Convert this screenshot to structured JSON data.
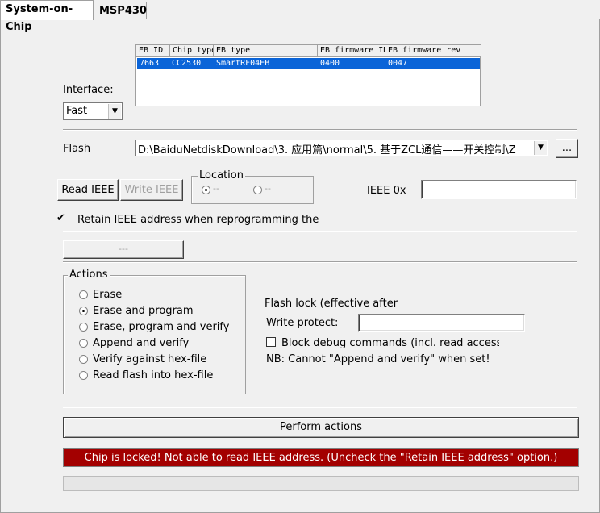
{
  "tabs": [
    {
      "label": "System-on-Chip",
      "active": true
    },
    {
      "label": "MSP430",
      "active": false
    }
  ],
  "interface": {
    "label": "Interface:",
    "value": "Fast"
  },
  "device_list": {
    "columns": [
      "EB ID",
      "Chip type",
      "EB type",
      "EB firmware ID",
      "EB firmware rev"
    ],
    "rows": [
      [
        "7663",
        "CC2530",
        "SmartRF04EB",
        "0400",
        "0047"
      ]
    ]
  },
  "flash": {
    "label": "Flash",
    "path": "D:\\BaiduNetdiskDownload\\3. 应用篇\\normal\\5. 基于ZCL通信——开关控制\\Z",
    "browse_label": "..."
  },
  "ieee": {
    "read_label": "Read IEEE",
    "write_label": "Write IEEE",
    "location_title": "Location",
    "location_options": [
      "--",
      "--"
    ],
    "label": "IEEE  0x",
    "value": ""
  },
  "retain": {
    "checked": true,
    "label": "Retain IEEE address when reprogramming the"
  },
  "secondary_button_label": "---",
  "actions": {
    "title": "Actions",
    "options": [
      "Erase",
      "Erase and program",
      "Erase, program and verify",
      "Append and verify",
      "Verify against hex-file",
      "Read flash into hex-file"
    ],
    "selected_index": 1
  },
  "flash_lock": {
    "title": "Flash lock (effective after",
    "write_protect_label": "Write protect:",
    "write_protect_value": "",
    "block_debug_label": "Block debug commands (incl. read access",
    "block_debug_checked": false,
    "note": "NB: Cannot \"Append and verify\" when set!"
  },
  "perform_label": "Perform actions",
  "status_message": "Chip is locked! Not able to read IEEE address. (Uncheck the \"Retain IEEE address\" option.)",
  "colors": {
    "status_bg": "#a30000",
    "selection": "#0a64d8"
  }
}
